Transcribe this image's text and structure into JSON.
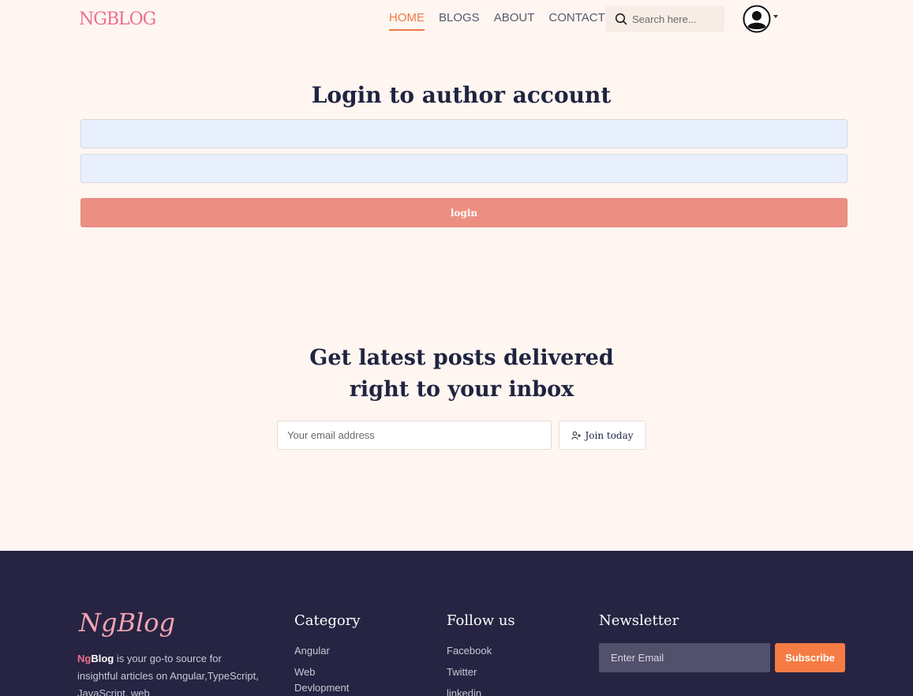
{
  "header": {
    "logo": "NGBLOG",
    "nav": [
      {
        "label": "HOME",
        "active": true
      },
      {
        "label": "BLOGS",
        "active": false
      },
      {
        "label": "ABOUT",
        "active": false
      },
      {
        "label": "CONTACT",
        "active": false
      }
    ],
    "search_placeholder": "Search here...",
    "accent_color": "#f07a45"
  },
  "login": {
    "title": "Login to author account",
    "username_value": "",
    "password_value": "",
    "button_label": "login",
    "button_color": "#ed8e83"
  },
  "newsletter": {
    "title": "Get latest posts delivered right to your inbox",
    "email_placeholder": "Your email address",
    "join_label": "Join today"
  },
  "footer": {
    "logo": "NgBlog",
    "desc_ng": "Ng",
    "desc_blog": "Blog",
    "desc_text": " is your go-to source for insightful articles on Angular,TypeScript, JavaScript, web",
    "category_title": "Category",
    "categories": [
      "Angular",
      "Web Devlopment"
    ],
    "follow_title": "Follow us",
    "follow": [
      "Facebook",
      "Twitter",
      "linkedin"
    ],
    "newsletter_title": "Newsletter",
    "email_placeholder": "Enter Email",
    "subscribe_label": "Subscribe",
    "background": "#262442"
  }
}
